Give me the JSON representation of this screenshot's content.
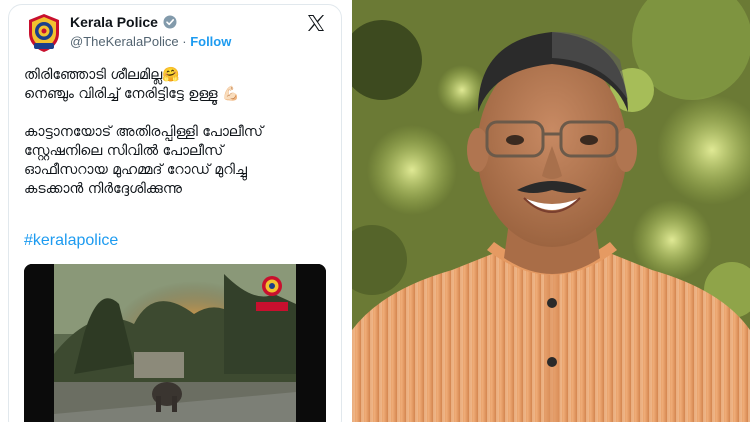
{
  "tweet": {
    "account_name": "Kerala Police",
    "handle": "@TheKeralaPolice",
    "separator": "·",
    "follow_label": "Follow",
    "lines": [
      "തിരിഞ്ഞോടി ശീലമില്ല🤗",
      "നെഞ്ചും വിരിച്ച് നേരിട്ടിട്ടേ ഉള്ളൂ 💪🏻",
      "കാട്ടാനയോട് അതിരപ്പിള്ളി പോലീസ്",
      "സ്റ്റേഷനിലെ സിവിൽ പോലീസ്",
      "ഓഫീസറായ മുഹമ്മദ് റോഡ് മുറിച്ചു",
      "കടക്കാൻ നിർദ്ദേശിക്കുന്നു"
    ],
    "hashtag": "#keralapolice",
    "video_badge": "Kerala POLICE"
  },
  "icons": {
    "verified": "verified-badge-icon",
    "x_logo": "x-logo-icon",
    "avatar": "kerala-police-emblem-icon"
  },
  "colors": {
    "link": "#1d9bf0",
    "text": "#0f1419",
    "muted": "#536471",
    "kurta": "#e8a06a"
  }
}
